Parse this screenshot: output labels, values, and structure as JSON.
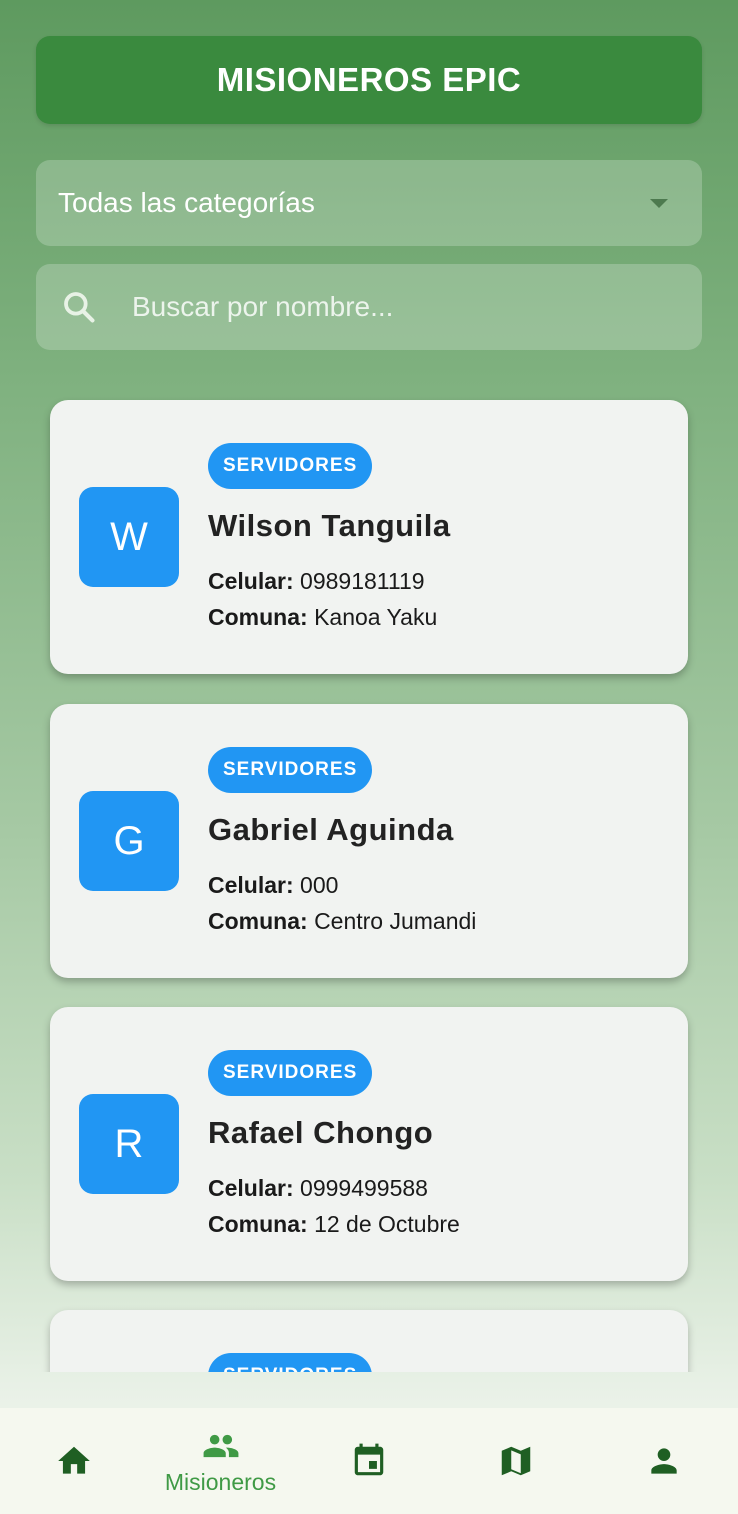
{
  "header": {
    "title": "MISIONEROS EPIC"
  },
  "filter": {
    "selected": "Todas las categorías"
  },
  "search": {
    "placeholder": "Buscar por nombre..."
  },
  "labels": {
    "phone": "Celular:",
    "community": "Comuna:"
  },
  "cards": [
    {
      "initial": "W",
      "category": "SERVIDORES",
      "name": "Wilson Tanguila",
      "phone": "0989181119",
      "community": "Kanoa Yaku"
    },
    {
      "initial": "G",
      "category": "SERVIDORES",
      "name": "Gabriel Aguinda",
      "phone": "000",
      "community": "Centro Jumandi"
    },
    {
      "initial": "R",
      "category": "SERVIDORES",
      "name": "Rafael Chongo",
      "phone": "0999499588",
      "community": "12 de Octubre"
    },
    {
      "initial": "",
      "category": "SERVIDORES",
      "name": "",
      "phone": "",
      "community": ""
    }
  ],
  "nav": {
    "items": [
      {
        "icon": "home-icon",
        "label": ""
      },
      {
        "icon": "people-icon",
        "label": "Misioneros",
        "active": true
      },
      {
        "icon": "calendar-icon",
        "label": ""
      },
      {
        "icon": "map-icon",
        "label": ""
      },
      {
        "icon": "person-icon",
        "label": ""
      }
    ]
  },
  "colors": {
    "header": "#3a8a3e",
    "accent": "#2196f3",
    "nav_icon": "#1f5f23",
    "nav_active_label": "#3f9a45"
  }
}
